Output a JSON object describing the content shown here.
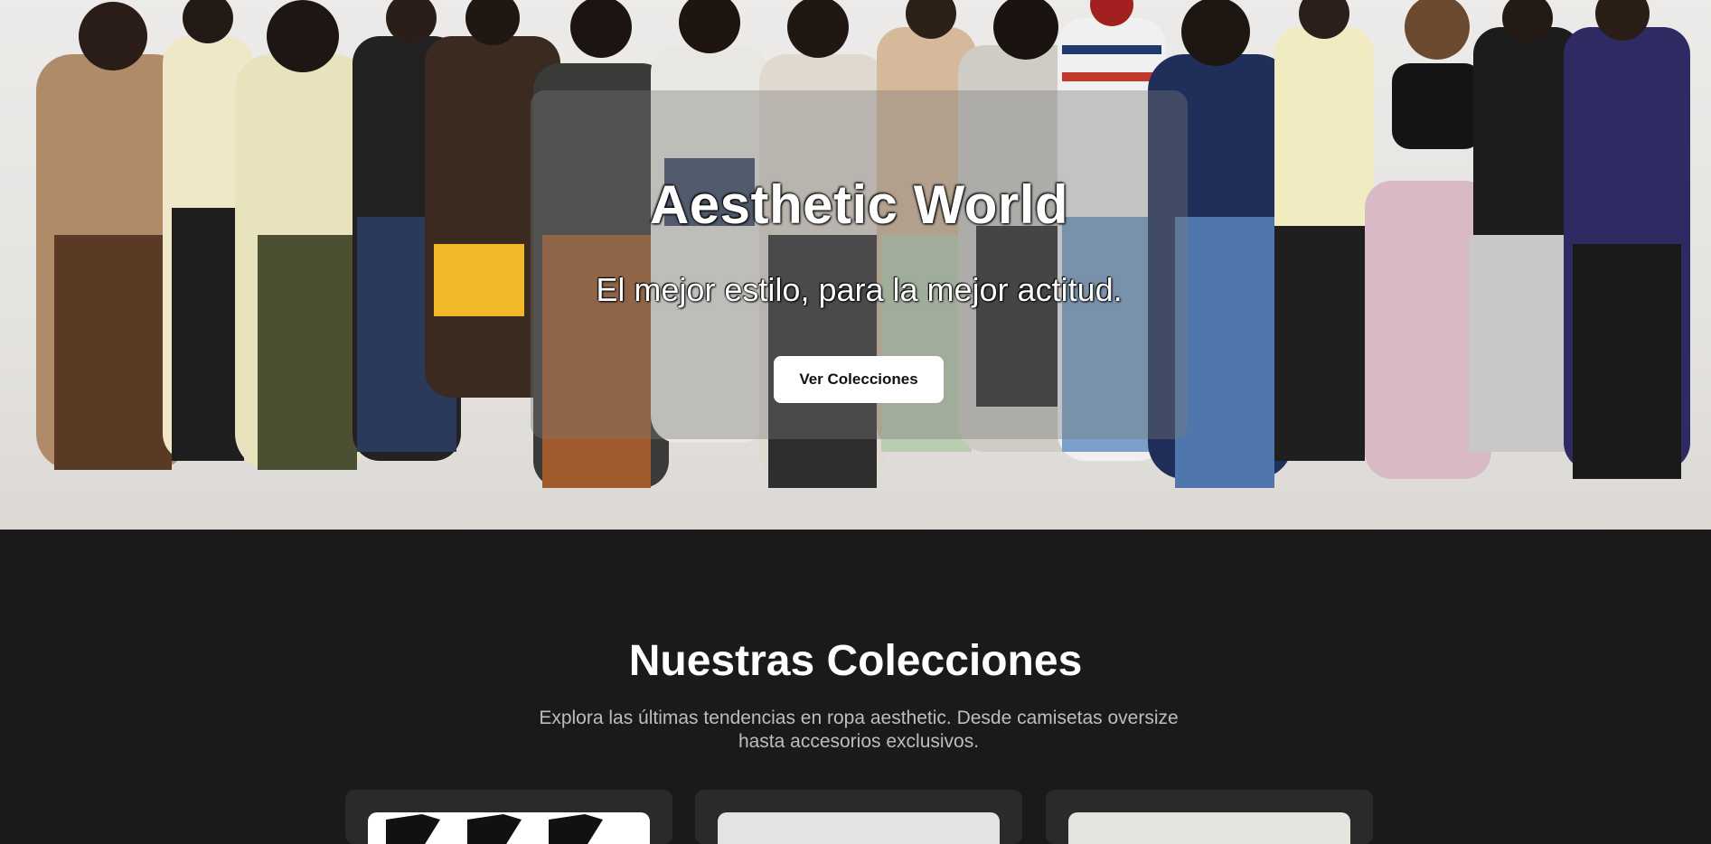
{
  "hero": {
    "title": "Aesthetic World",
    "tagline": "El mejor estilo, para la mejor actitud.",
    "cta_label": "Ver Colecciones"
  },
  "collections": {
    "title": "Nuestras Colecciones",
    "description": "Explora las últimas tendencias en ropa aesthetic. Desde camisetas oversize hasta accesorios exclusivos."
  },
  "colors": {
    "page_background": "#1a1a1a",
    "card_background": "#2a2a2a",
    "cta_background": "#ffffff"
  }
}
